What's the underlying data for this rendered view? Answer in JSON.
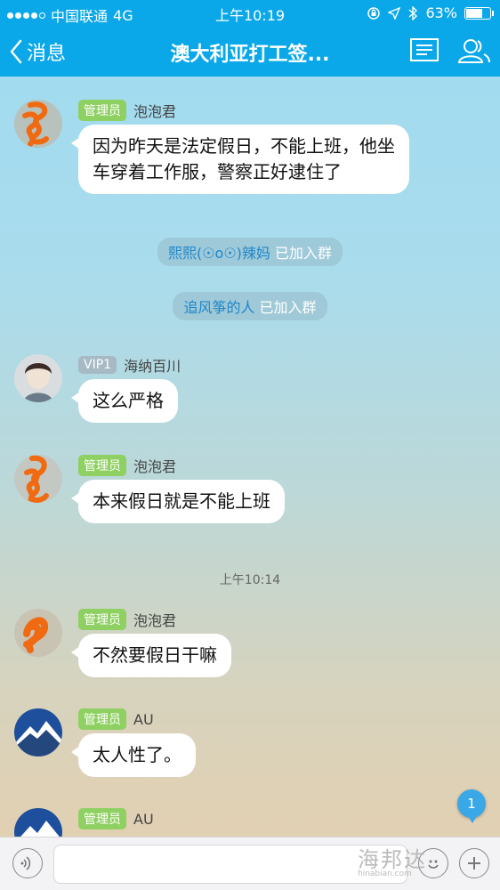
{
  "status_bar": {
    "carrier": "中国联通",
    "network": "4G",
    "time": "上午10:19",
    "battery": "63%",
    "battery_level": 0.63
  },
  "nav": {
    "back_label": "消息",
    "title": "澳大利亚打工签...",
    "icons": [
      "group-info-icon",
      "members-icon"
    ]
  },
  "messages": [
    {
      "role": "管理员",
      "sender": "泡泡君",
      "text": "因为昨天是法定假日，不能上班，他坐车穿着工作服，警察正好逮住了"
    },
    {
      "role": "VIP1",
      "sender": "海纳百川",
      "text": "这么严格"
    },
    {
      "role": "管理员",
      "sender": "泡泡君",
      "text": "本来假日就是不能上班"
    },
    {
      "role": "管理员",
      "sender": "泡泡君",
      "text": "不然要假日干嘛"
    },
    {
      "role": "管理员",
      "sender": "AU",
      "text": "太人性了。"
    },
    {
      "role": "管理员",
      "sender": "AU"
    }
  ],
  "system_notices": [
    {
      "name": "熙熙(☉o☉)辣妈",
      "action": "已加入群"
    },
    {
      "name": "追风筝的人",
      "action": "已加入群"
    }
  ],
  "timestamp": "上午10:14",
  "unread_count": "1",
  "watermark": {
    "text": "海邦达",
    "sub": "hinabian.com"
  },
  "colors": {
    "nav": "#0aa8e8",
    "admin_badge": "#8fd062",
    "vip_badge": "#a7b9c4",
    "link": "#1f86c9"
  }
}
